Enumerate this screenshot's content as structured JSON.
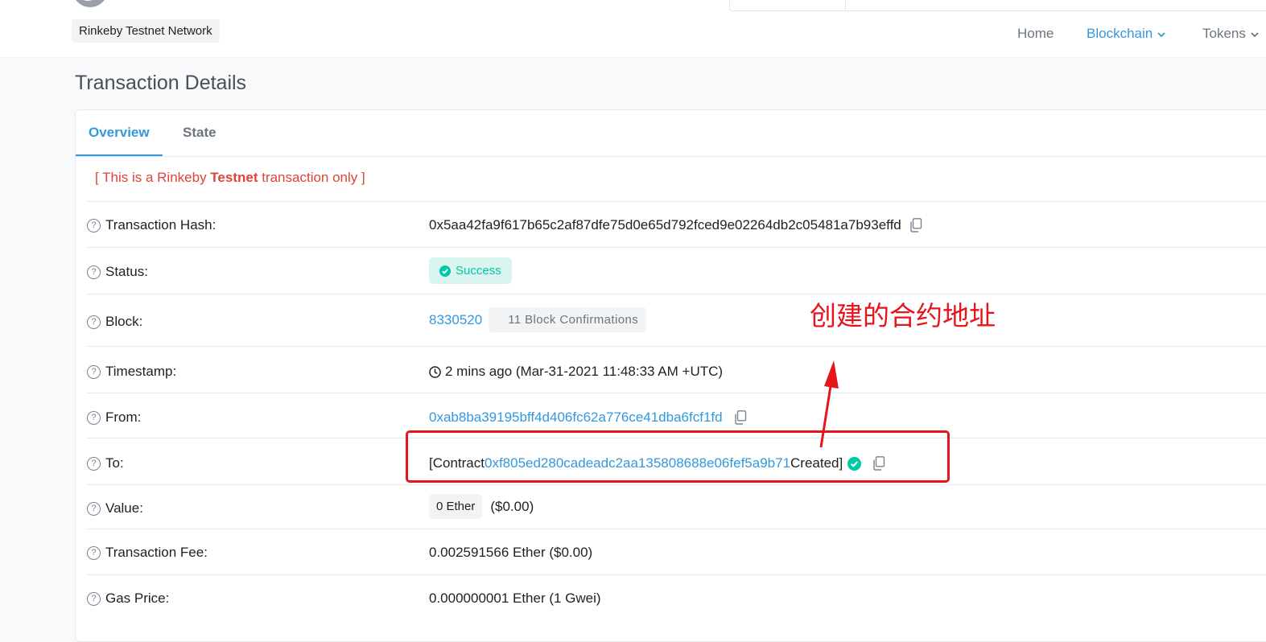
{
  "header": {
    "network_badge": "Rinkeby Testnet Network",
    "nav": [
      {
        "label": "Home",
        "active": false
      },
      {
        "label": "Blockchain",
        "active": true
      },
      {
        "label": "Tokens",
        "active": false
      }
    ]
  },
  "page": {
    "title": "Transaction Details",
    "tabs": [
      {
        "label": "Overview",
        "active": true
      },
      {
        "label": "State",
        "active": false
      }
    ],
    "notice": {
      "prefix": "[ This is a Rinkeby ",
      "bold": "Testnet",
      "suffix": " transaction only ]"
    }
  },
  "details": {
    "hash": {
      "label": "Transaction Hash:",
      "value": "0x5aa42fa9f617b65c2af87dfe75d0e65d792fced9e02264db2c05481a7b93effd"
    },
    "status": {
      "label": "Status:",
      "value": "Success"
    },
    "block": {
      "label": "Block:",
      "value": "8330520",
      "confirmations": "11 Block Confirmations"
    },
    "timestamp": {
      "label": "Timestamp:",
      "value": "2 mins ago (Mar-31-2021 11:48:33 AM +UTC)"
    },
    "from": {
      "label": "From:",
      "value": "0xab8ba39195bff4d406fc62a776ce41dba6fcf1fd"
    },
    "to": {
      "label": "To:",
      "prefix": "[Contract ",
      "address": "0xf805ed280cadeadc2aa135808688e06fef5a9b71",
      "suffix": " Created]"
    },
    "value": {
      "label": "Value:",
      "badge": "0 Ether",
      "usd": "($0.00)"
    },
    "fee": {
      "label": "Transaction Fee:",
      "value": "0.002591566 Ether ($0.00)"
    },
    "gas_price": {
      "label": "Gas Price:",
      "value": "0.000000001 Ether (1 Gwei)"
    }
  },
  "annotation": {
    "text": "创建的合约地址",
    "color": "#e8141b"
  },
  "colors": {
    "accent": "#3498db",
    "success": "#00c9a7",
    "danger": "#de4437"
  }
}
